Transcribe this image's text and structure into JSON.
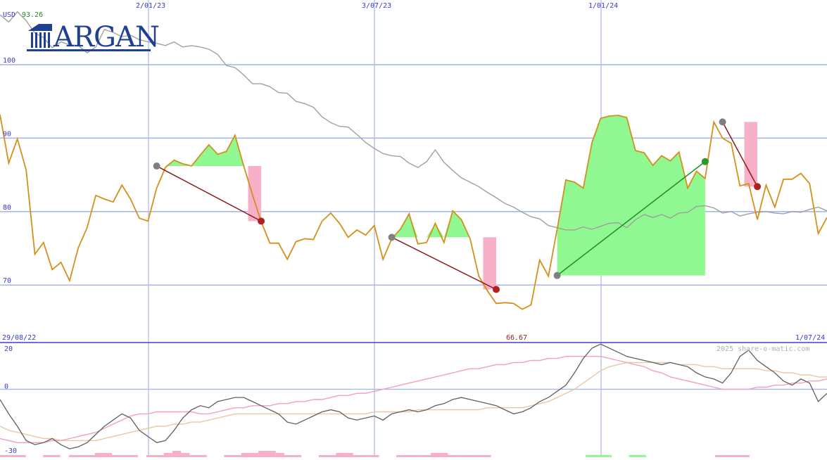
{
  "header": {
    "currency": "USD",
    "last_price": "93.26"
  },
  "logo": {
    "text": "ARGAN"
  },
  "footer": {
    "start_date": "29/08/22",
    "min_value": "66.67",
    "end_date": "1/07/24",
    "watermark": "2025 share-o-matic.com"
  },
  "colors": {
    "price": "#d4901a",
    "ma": "#a0a0a0",
    "grid": "#a8b8ee",
    "axis_text": "#3a3acc",
    "gain_fill": "#90f890",
    "loss_fill": "#f8b0c8",
    "loss_line": "#8b1a1a",
    "gain_line": "#228b22",
    "osc_line": "#606060",
    "osc_pink": "#f0a0c0",
    "osc_tan": "#e8c8a0"
  },
  "chart_data": [
    {
      "type": "line",
      "ylabel": "",
      "ylim": [
        63.8,
        108.8
      ],
      "x_ticks": [
        "2/01/23",
        "3/07/23",
        "1/01/24"
      ],
      "y_ticks": [
        70,
        80,
        90,
        100
      ],
      "series": [
        {
          "values": [
            93.2,
            86.6,
            89.9,
            85.7,
            74.2,
            75.8,
            72.1,
            73.1,
            70.6,
            75.1,
            77.8,
            82.2,
            81.7,
            81.3,
            83.6,
            81.7,
            79.1,
            78.7,
            83.2,
            86.0,
            87.0,
            86.5,
            86.2,
            87.7,
            89.1,
            87.8,
            88.2,
            90.4,
            86.2,
            82.3,
            78.6,
            75.7,
            75.7,
            73.5,
            75.9,
            76.3,
            76.2,
            78.7,
            79.8,
            78.4,
            76.5,
            77.5,
            76.8,
            78.1,
            73.5,
            76.3,
            77.6,
            79.7,
            75.6,
            75.8,
            78.4,
            75.8,
            80.1,
            78.9,
            76.3,
            71.2,
            69.2,
            67.5,
            67.6,
            67.5,
            66.7,
            67.3,
            73.4,
            71.2,
            77.6,
            84.3,
            84.0,
            83.2,
            89.4,
            92.7,
            93.0,
            93.1,
            92.8,
            88.3,
            88.0,
            86.3,
            87.6,
            86.9,
            88.1,
            83.2,
            85.5,
            84.5,
            92.2,
            90.0,
            89.3,
            83.5,
            83.8,
            78.9,
            83.6,
            80.6,
            84.4,
            84.4,
            85.2,
            83.8,
            77.0,
            79.2
          ]
        },
        {
          "values": [
            106.8,
            105.8,
            107.2,
            106.0,
            104.3,
            103.7,
            102.3,
            103.1,
            102.7,
            102.6,
            101.6,
            102.4,
            104.8,
            104.4,
            103.8,
            104.0,
            103.4,
            103.1,
            102.9,
            102.6,
            103.1,
            102.4,
            102.6,
            102.4,
            102.1,
            101.4,
            99.9,
            99.6,
            98.6,
            97.4,
            97.4,
            97.0,
            96.2,
            96.1,
            95.0,
            94.7,
            94.2,
            92.9,
            92.1,
            91.6,
            91.5,
            90.5,
            89.4,
            88.6,
            87.9,
            87.6,
            87.5,
            86.6,
            86.0,
            86.8,
            88.4,
            86.7,
            85.6,
            84.6,
            84.0,
            83.4,
            82.6,
            81.9,
            81.1,
            80.6,
            79.9,
            79.3,
            79.0,
            78.1,
            77.8,
            77.5,
            77.5,
            77.9,
            77.6,
            78.0,
            78.4,
            78.5,
            77.8,
            78.9,
            79.6,
            79.2,
            79.6,
            79.1,
            79.8,
            79.9,
            80.7,
            80.8,
            80.5,
            79.8,
            80.0,
            79.4,
            79.7,
            79.9,
            80.0,
            79.8,
            79.7,
            80.0,
            79.9,
            80.3,
            80.6,
            80.1
          ]
        }
      ],
      "trades": [
        {
          "entry": 86.2,
          "exit": 78.7,
          "peak": 90.4,
          "result": "loss"
        },
        {
          "entry": 76.5,
          "exit": 69.4,
          "peak": 79.9,
          "result": "loss"
        },
        {
          "entry": 71.3,
          "exit": 86.8,
          "peak": 93.1,
          "result": "gain"
        },
        {
          "entry": 92.2,
          "exit": 83.4,
          "peak": 92.2,
          "result": "loss"
        }
      ]
    },
    {
      "type": "line",
      "ylim": [
        -30,
        20
      ],
      "y_ticks": [
        20,
        0,
        -30
      ],
      "series": [
        {
          "values": [
            -5,
            -12,
            -18,
            -25,
            -27,
            -26,
            -24,
            -27,
            -29,
            -28,
            -26,
            -22,
            -18,
            -15,
            -12,
            -14,
            -20,
            -23,
            -26,
            -25,
            -20,
            -14,
            -10,
            -8,
            -9,
            -6,
            -5,
            -4,
            -4,
            -6,
            -8,
            -10,
            -12,
            -16,
            -17,
            -15,
            -13,
            -11,
            -10,
            -11,
            -14,
            -15,
            -14,
            -13,
            -15,
            -12,
            -11,
            -10,
            -11,
            -10,
            -8,
            -7,
            -5,
            -4,
            -5,
            -6,
            -7,
            -8,
            -10,
            -12,
            -11,
            -9,
            -6,
            -4,
            -1,
            2,
            8,
            15,
            20,
            22,
            20,
            18,
            16,
            15,
            14,
            13,
            12,
            13,
            12,
            11,
            8,
            6,
            5,
            3,
            8,
            16,
            19,
            14,
            11,
            8,
            4,
            2,
            5,
            3,
            -6,
            -2
          ]
        },
        {
          "values": [
            -24,
            -25,
            -26,
            -26,
            -26,
            -26,
            -25,
            -25,
            -24,
            -23,
            -22,
            -21,
            -19,
            -17,
            -15,
            -13,
            -12,
            -12,
            -11,
            -11,
            -11,
            -11,
            -11,
            -12,
            -12,
            -11,
            -10,
            -9,
            -9,
            -8,
            -8,
            -8,
            -7,
            -7,
            -6,
            -6,
            -5,
            -5,
            -4,
            -3,
            -3,
            -2,
            -2,
            -1,
            0,
            1,
            2,
            3,
            4,
            5,
            6,
            7,
            8,
            9,
            10,
            10,
            11,
            12,
            12,
            13,
            13,
            14,
            14,
            15,
            15,
            16,
            16,
            16,
            16,
            16,
            15,
            14,
            13,
            12,
            11,
            9,
            8,
            6,
            5,
            4,
            3,
            2,
            1,
            0,
            0,
            0,
            0,
            1,
            1,
            2,
            2,
            3,
            3,
            4,
            4,
            5
          ]
        },
        {
          "values": [
            -18,
            -20,
            -21,
            -22,
            -23,
            -24,
            -24,
            -25,
            -25,
            -25,
            -25,
            -25,
            -24,
            -23,
            -22,
            -21,
            -20,
            -19,
            -18,
            -18,
            -17,
            -17,
            -16,
            -16,
            -15,
            -14,
            -13,
            -12,
            -12,
            -12,
            -12,
            -12,
            -12,
            -12,
            -12,
            -12,
            -12,
            -12,
            -12,
            -12,
            -12,
            -12,
            -12,
            -11,
            -11,
            -11,
            -11,
            -11,
            -10,
            -10,
            -10,
            -10,
            -10,
            -10,
            -10,
            -10,
            -9,
            -9,
            -9,
            -9,
            -9,
            -8,
            -7,
            -6,
            -4,
            -2,
            0,
            3,
            6,
            9,
            11,
            12,
            13,
            13,
            13,
            13,
            13,
            13,
            12,
            12,
            12,
            11,
            11,
            10,
            10,
            10,
            10,
            10,
            9,
            9,
            8,
            8,
            7,
            7,
            6,
            6
          ]
        }
      ],
      "volume_hint": [
        1,
        1,
        1,
        0,
        0,
        1,
        1,
        0,
        1,
        1,
        1,
        2,
        2,
        1,
        1,
        1,
        0,
        1,
        1,
        2,
        3,
        2,
        1,
        1,
        0,
        0,
        1,
        1,
        2,
        2,
        3,
        3,
        2,
        1,
        1,
        0,
        0,
        1,
        1,
        2,
        2,
        1,
        1,
        1,
        0,
        0,
        1,
        1,
        1,
        1,
        2,
        2,
        1,
        1,
        1,
        1,
        1,
        0,
        0,
        0,
        0,
        0,
        0,
        0,
        0,
        0,
        0,
        0,
        1,
        1,
        1,
        0,
        0,
        1,
        1,
        0,
        0,
        0,
        0,
        0,
        0,
        0,
        0,
        1,
        1,
        1,
        1,
        0,
        0,
        0,
        0,
        0,
        0,
        0,
        0,
        0
      ],
      "volume_sign": [
        -1,
        -1,
        -1,
        -1,
        -1,
        -1,
        -1,
        -1,
        -1,
        -1,
        -1,
        -1,
        -1,
        -1,
        -1,
        -1,
        -1,
        -1,
        -1,
        -1,
        -1,
        -1,
        -1,
        -1,
        -1,
        -1,
        -1,
        -1,
        -1,
        -1,
        -1,
        -1,
        -1,
        -1,
        -1,
        -1,
        -1,
        -1,
        -1,
        -1,
        -1,
        -1,
        -1,
        -1,
        -1,
        -1,
        -1,
        -1,
        -1,
        -1,
        -1,
        -1,
        -1,
        -1,
        -1,
        -1,
        -1,
        -1,
        -1,
        -1,
        -1,
        -1,
        -1,
        -1,
        -1,
        -1,
        -1,
        -1,
        1,
        1,
        1,
        1,
        1,
        1,
        1,
        1,
        1,
        1,
        1,
        1,
        1,
        1,
        1,
        -1,
        -1,
        -1,
        -1,
        -1,
        -1,
        -1,
        -1,
        -1,
        -1,
        -1,
        -1,
        -1
      ]
    }
  ]
}
